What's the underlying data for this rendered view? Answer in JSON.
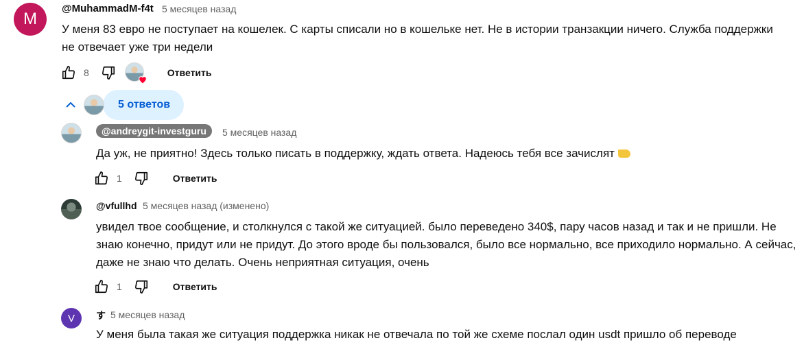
{
  "comments": [
    {
      "author": "@MuhammadM-f4t",
      "avatar_letter": "M",
      "avatar_color": "#c2185b",
      "timestamp": "5 месяцев назад",
      "text": "У меня 83 евро не поступает на кошелек. С карты списали но в кошельке нет. Не в истории транзакции ничего. Служба поддержки не отвечает уже три недели",
      "likes": "8",
      "reply_label": "Ответить"
    }
  ],
  "replies_toggle": {
    "label": "5 ответов"
  },
  "replies": [
    {
      "author": "@andreygit-investguru",
      "timestamp": "5 месяцев назад",
      "text": "Да уж, не приятно! Здесь только писать в поддержку, ждать ответа. Надеюсь тебя все зачислят",
      "emoji": "handshake-emoji",
      "likes": "1",
      "reply_label": "Ответить"
    },
    {
      "author": "@vfullhd",
      "timestamp": "5 месяцев назад (изменено)",
      "text": "увидел твое сообщение, и столкнулся с такой же ситуацией. было переведено 340$, пару часов назад и так и не пришли. Не знаю конечно, придут или не придут. До этого вроде бы пользовался, было все нормально, все приходило нормально. А сейчас, даже не знаю что делать. Очень неприятная ситуация, очень",
      "likes": "1",
      "reply_label": "Ответить"
    },
    {
      "author": "す",
      "avatar_letter": "V",
      "avatar_color": "#5e35b1",
      "timestamp": "5 месяцев назад",
      "text": "У меня была такая же ситуация поддержка никак не отвечала по той же схеме послал один usdt пришло об переводе"
    }
  ],
  "colors": {
    "link_blue": "#065fd4",
    "pill_bg": "#def1ff",
    "meta_gray": "#606060",
    "heart_red": "#ff0033"
  }
}
